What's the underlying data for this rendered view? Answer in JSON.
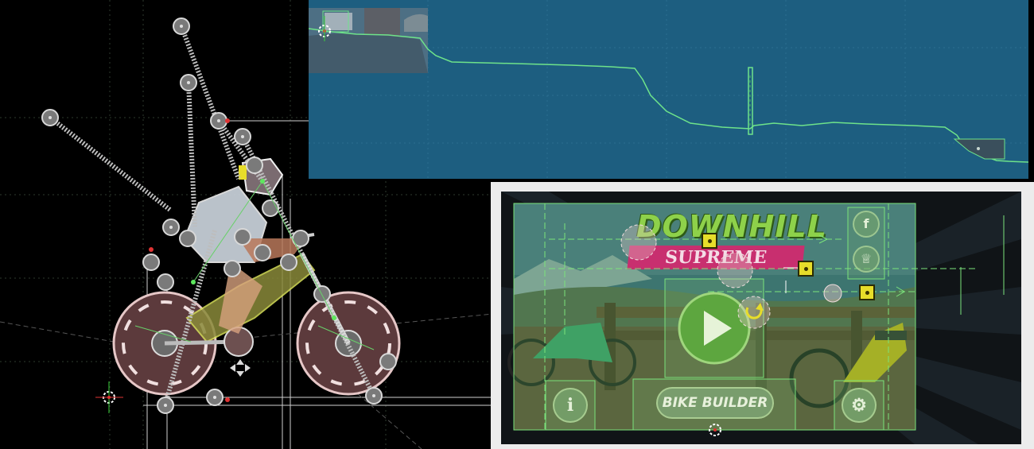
{
  "panels": {
    "rig_editor": {
      "name": "bike rider rig editor"
    },
    "level_preview": {
      "name": "downhill level preview"
    },
    "menu_editor": {
      "name": "main menu layout editor"
    }
  },
  "menu": {
    "title_top": "DOWNHILL",
    "title_bottom": "SUPREME",
    "bike_builder_label": "BIKE BUILDER",
    "info_icon": "i",
    "facebook_icon": "f",
    "settings_icon": "⚙",
    "play_icon": "▶"
  },
  "colors": {
    "rig_background": "#000000",
    "level_background": "#1d5e80",
    "terrain_line": "#6ee38a",
    "selection_green": "#7be37b",
    "handle_yellow": "#e7dd2a",
    "title_green": "#8ed14a",
    "title_pink": "#c82f6f"
  }
}
